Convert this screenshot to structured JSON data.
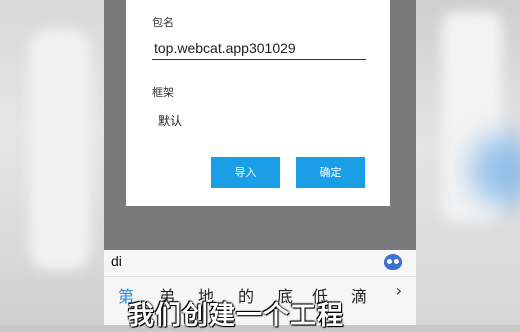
{
  "dialog": {
    "package_label": "包名",
    "package_value": "top.webcat.app301029",
    "framework_label": "框架",
    "framework_value": "默认",
    "import_button": "导入",
    "confirm_button": "确定"
  },
  "ime": {
    "input_text": "di",
    "candidates": [
      "第",
      "弟",
      "地",
      "的",
      "底",
      "低",
      "滴"
    ],
    "more_symbol": "›"
  },
  "subtitle": "我们创建一个工程"
}
